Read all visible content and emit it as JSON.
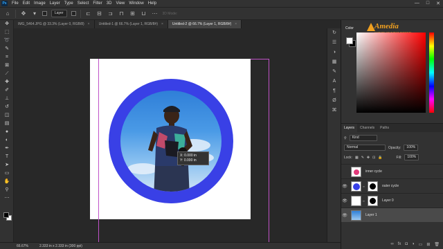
{
  "menubar": {
    "app_badge": "Ps",
    "items": [
      "File",
      "Edit",
      "Image",
      "Layer",
      "Type",
      "Select",
      "Filter",
      "3D",
      "View",
      "Window",
      "Help"
    ],
    "window_controls": [
      "—",
      "□",
      "✕"
    ]
  },
  "options": {
    "auto_select_target": "Layer",
    "mode_3d": "3D Mode:"
  },
  "tabs": [
    {
      "label": "IMG_5464.JPG @ 33.3% (Layer 0, RGB/8)",
      "close": "×",
      "active": false
    },
    {
      "label": "Untitled-1 @ 66.7% (Layer 1, RGB/8#)",
      "close": "×",
      "active": false
    },
    {
      "label": "Untitled-2 @ 66.7% (Layer 1, RGB/8#)",
      "close": "×",
      "active": true
    }
  ],
  "canvas": {
    "transform_readout": [
      "X: 0.000 in",
      "Y: 0.000 in"
    ],
    "ring_color": "#3940e6"
  },
  "status": {
    "zoom": "66.67%",
    "doc_info": "2.333 in x 2.333 in (300 ppi)"
  },
  "color_panel": {
    "tab": "Color",
    "brand_name": "Amedia",
    "brand_tagline": "CAPTURE YOUR BEST MOMENTS"
  },
  "layers_panel": {
    "tabs": [
      "Layers",
      "Channels",
      "Paths"
    ],
    "filter_kind": "Kind",
    "blend_mode": "Normal",
    "opacity_label": "Opacity:",
    "opacity_value": "100%",
    "lock_label": "Lock:",
    "fill_label": "Fill:",
    "fill_value": "100%",
    "layers": [
      {
        "name": "inner cycle",
        "visible": false,
        "thumb_color": "#e23a7a",
        "has_mask": false,
        "selected": false
      },
      {
        "name": "outer cycle",
        "visible": true,
        "thumb_color": "#3940e6",
        "has_mask": true,
        "selected": false
      },
      {
        "name": "Layer 0",
        "visible": true,
        "thumb_color": "#ffffff",
        "has_mask": true,
        "selected": false
      },
      {
        "name": "Layer 1",
        "visible": true,
        "thumb_color": "#3a8ad8",
        "has_mask": false,
        "selected": true
      }
    ],
    "footer_icons": [
      "link-icon",
      "fx-icon",
      "mask-icon",
      "adjustment-icon",
      "folder-icon",
      "new-layer-icon",
      "trash-icon"
    ]
  }
}
